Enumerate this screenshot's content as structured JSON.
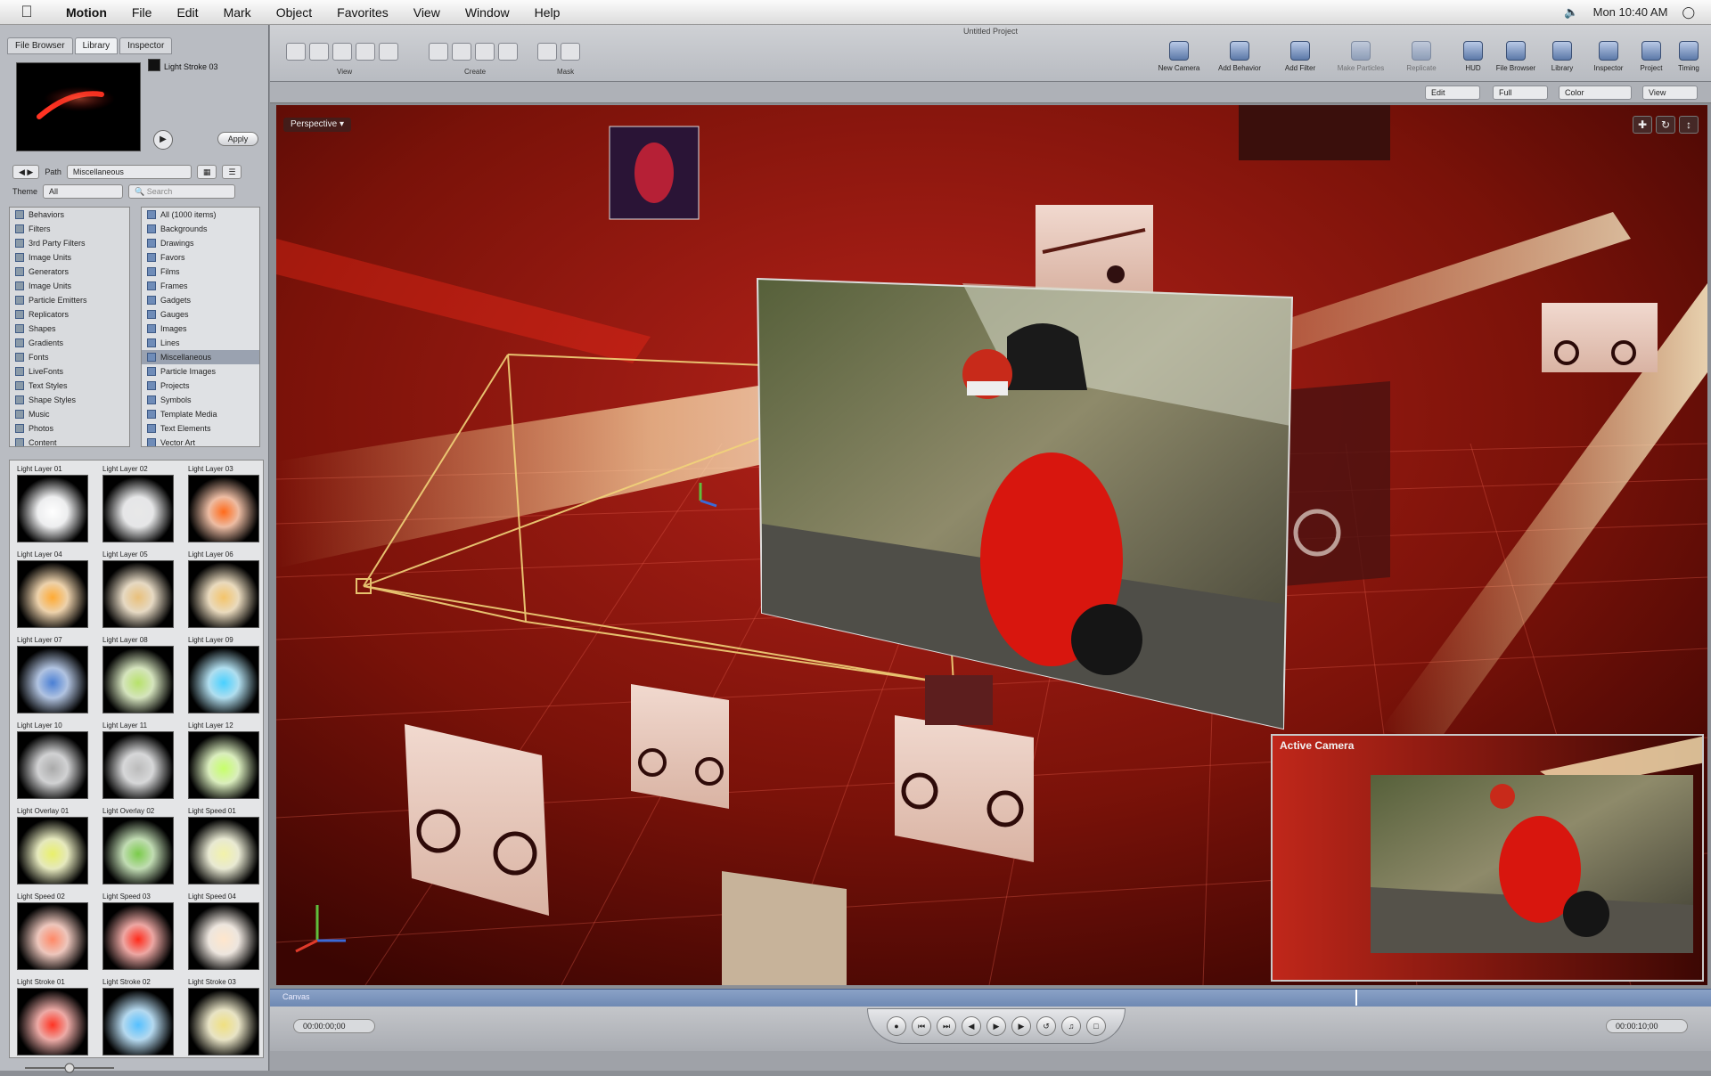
{
  "menubar": {
    "app": "Motion",
    "items": [
      "File",
      "Edit",
      "Mark",
      "Object",
      "Favorites",
      "View",
      "Window",
      "Help"
    ],
    "clock": "Mon 10:40 AM"
  },
  "window": {
    "title": "Untitled Project"
  },
  "left_panel": {
    "tabs": [
      "File Browser",
      "Library",
      "Inspector"
    ],
    "preview_title": "Light Stroke 03",
    "apply_label": "Apply",
    "path_label": "Path",
    "path_value": "Miscellaneous",
    "theme_label": "Theme",
    "theme_value": "All",
    "search_placeholder": "Search",
    "categories": [
      "Behaviors",
      "Filters",
      "3rd Party Filters",
      "Image Units",
      "Generators",
      "Image Units",
      "Particle Emitters",
      "Replicators",
      "Shapes",
      "Gradients",
      "Fonts",
      "LiveFonts",
      "Text Styles",
      "Shape Styles",
      "Music",
      "Photos",
      "Content"
    ],
    "subcategories": [
      "All (1000 items)",
      "Backgrounds",
      "Drawings",
      "Favors",
      "Films",
      "Frames",
      "Gadgets",
      "Gauges",
      "Images",
      "Lines",
      "Miscellaneous",
      "Particle Images",
      "Projects",
      "Symbols",
      "Template Media",
      "Text Elements",
      "Vector Art"
    ],
    "selected_subcategory_index": 10,
    "thumbnails": [
      "Light Layer 01",
      "Light Layer 02",
      "Light Layer 03",
      "Light Layer 04",
      "Light Layer 05",
      "Light Layer 06",
      "Light Layer 07",
      "Light Layer 08",
      "Light Layer 09",
      "Light Layer 10",
      "Light Layer 11",
      "Light Layer 12",
      "Light Overlay 01",
      "Light Overlay 02",
      "Light Speed 01",
      "Light Speed 02",
      "Light Speed 03",
      "Light Speed 04",
      "Light Stroke 01",
      "Light Stroke 02",
      "Light Stroke 03"
    ]
  },
  "toolbar": {
    "groups": [
      "View",
      "Create",
      "Mask"
    ],
    "right_tools": [
      "New Camera",
      "Add Behavior",
      "Add Filter",
      "Make Particles",
      "Replicate",
      "HUD",
      "File Browser",
      "Library",
      "Inspector",
      "Project",
      "Timing"
    ],
    "dropdowns": [
      "Edit",
      "Full",
      "Color",
      "View"
    ]
  },
  "canvas": {
    "view_label": "Perspective",
    "active_camera_label": "Active Camera"
  },
  "timebar": {
    "label": "Canvas"
  },
  "transport": {
    "left_timecode": "00:00:00;00",
    "right_timecode": "00:00:10;00"
  },
  "colors": {
    "canvas_bg": "#5e0d07",
    "timebar": "#6f89b3"
  }
}
